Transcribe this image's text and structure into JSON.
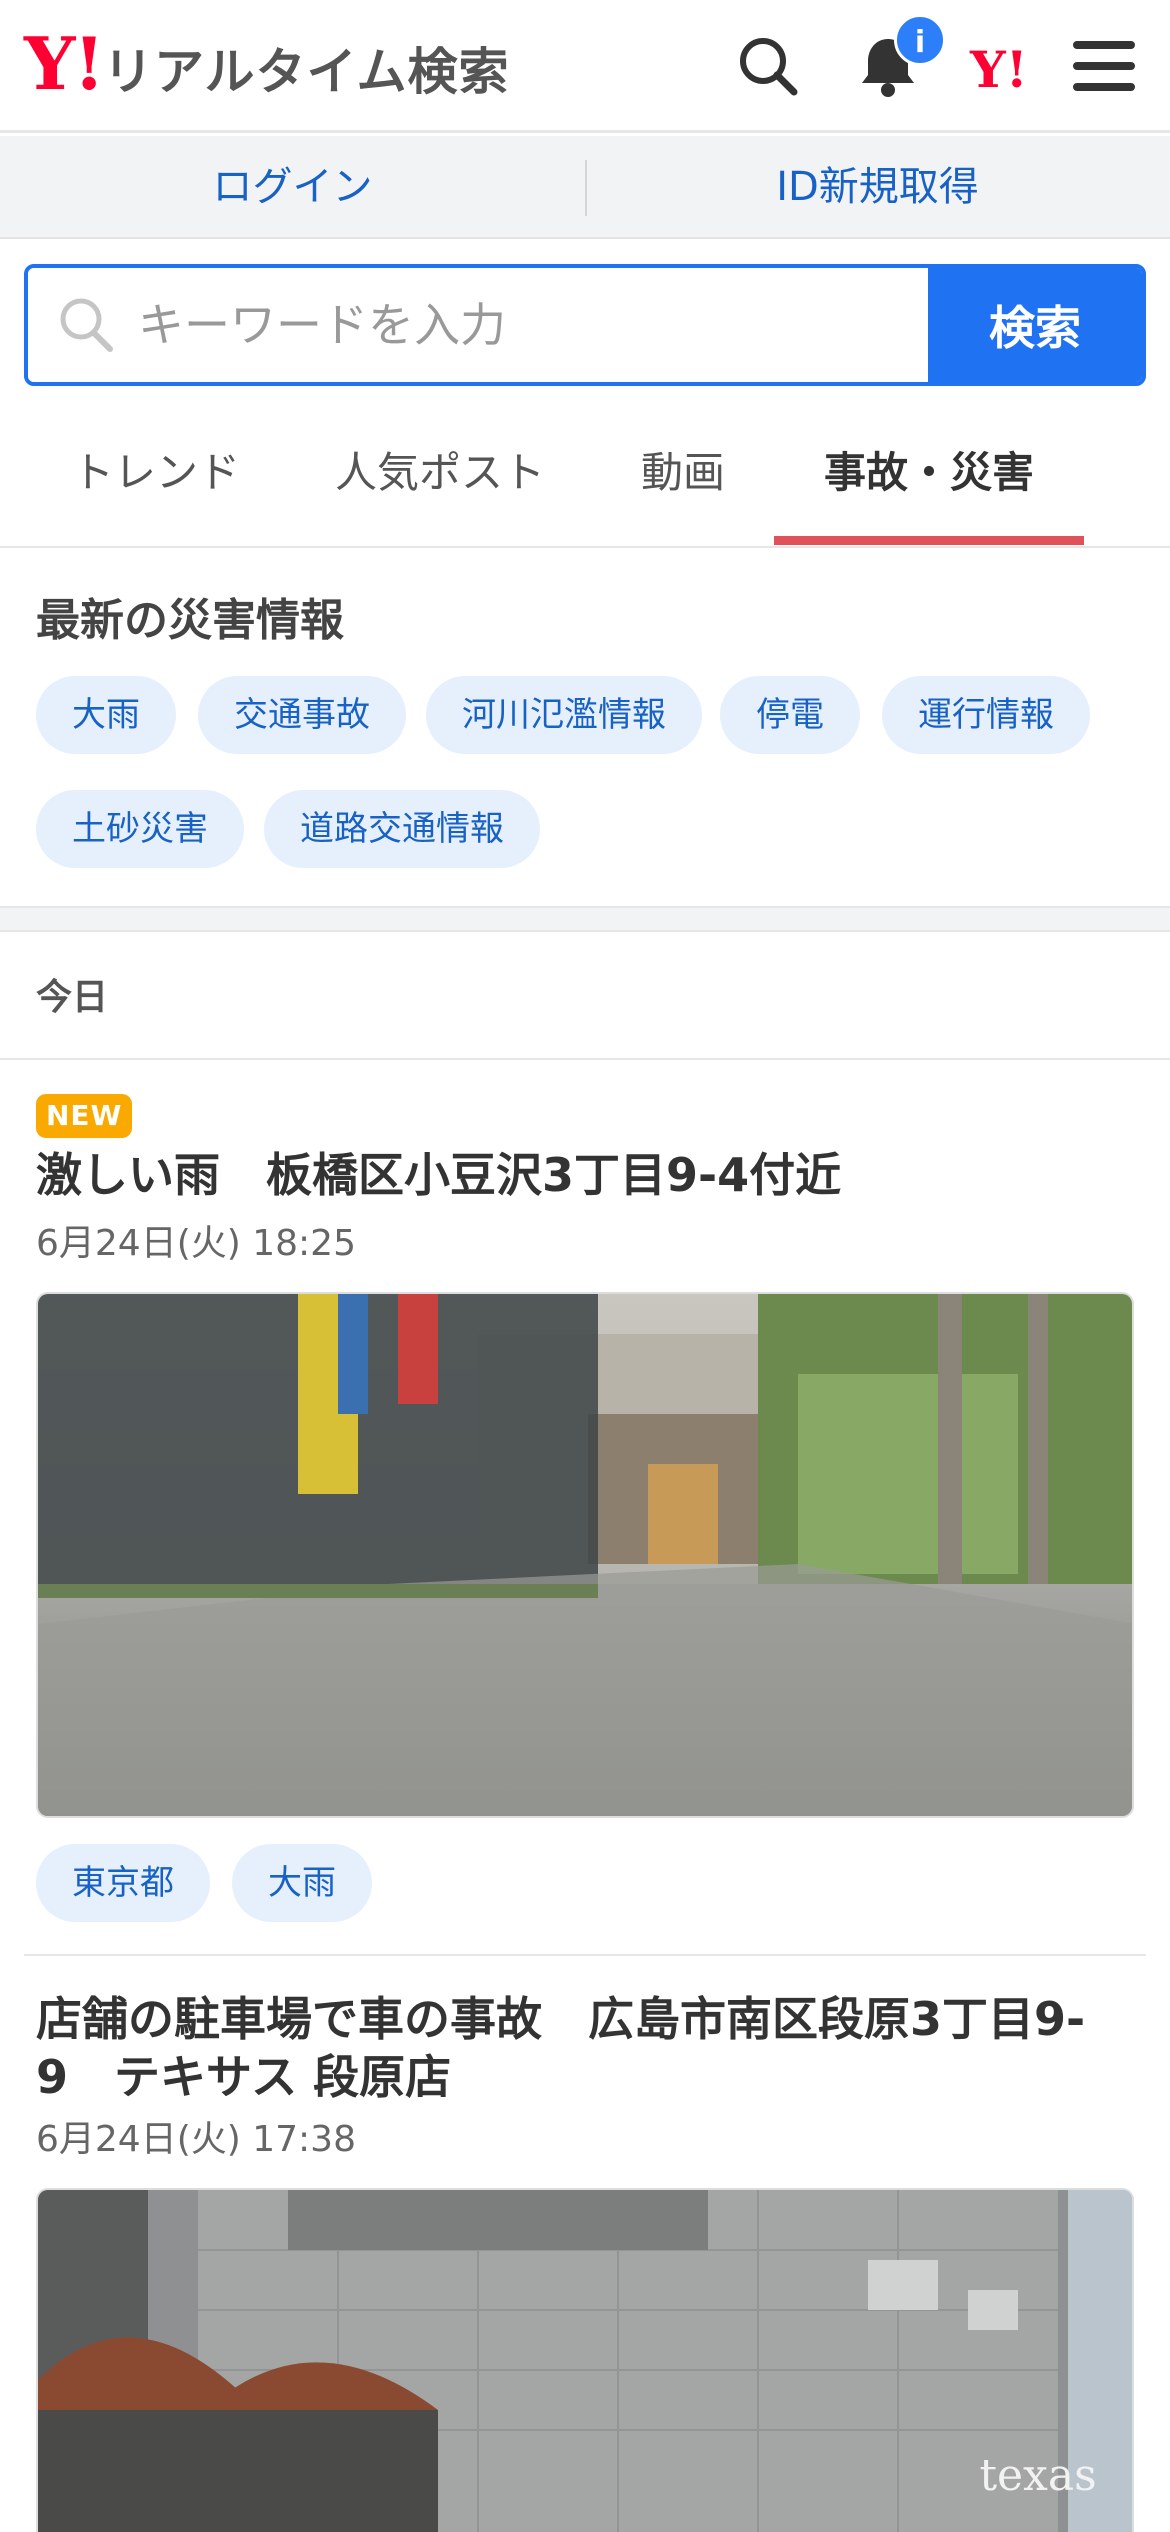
{
  "header": {
    "logo_mark": "Y!",
    "logo_text": "リアルタイム検索",
    "notification_badge": "i",
    "yahoo_japan_mark": "Y!"
  },
  "login_bar": {
    "login_label": "ログイン",
    "register_label": "ID新規取得"
  },
  "search": {
    "placeholder": "キーワードを入力",
    "value": "",
    "button_label": "検索"
  },
  "tabs": [
    {
      "label": "トレンド",
      "active": false
    },
    {
      "label": "人気ポスト",
      "active": false
    },
    {
      "label": "動画",
      "active": false
    },
    {
      "label": "事故・災害",
      "active": true
    }
  ],
  "disaster_info": {
    "title": "最新の災害情報",
    "chips": [
      "大雨",
      "交通事故",
      "河川氾濫情報",
      "停電",
      "運行情報",
      "土砂災害",
      "道路交通情報"
    ]
  },
  "section_label": "今日",
  "posts": [
    {
      "badge": "NEW",
      "title": "激しい雨　板橋区小豆沢3丁目9-4付近",
      "time": "6月24日(火) 18:25",
      "tags": [
        "東京都",
        "大雨"
      ]
    },
    {
      "title_line1": "店舗の駐車場で車の事故　広島市南区段原3丁目9-",
      "title_line2": "9　テキサス 段原店",
      "time": "6月24日(火) 17:38",
      "image_sign": "texas"
    }
  ],
  "colors": {
    "brand_red": "#ff0033",
    "accent_blue": "#1f72f2",
    "link_blue": "#1862c5",
    "tab_underline": "#e0525a",
    "new_badge": "#f9a900"
  },
  "icons": [
    "search-icon",
    "bell-icon",
    "menu-icon",
    "search-field-icon"
  ]
}
